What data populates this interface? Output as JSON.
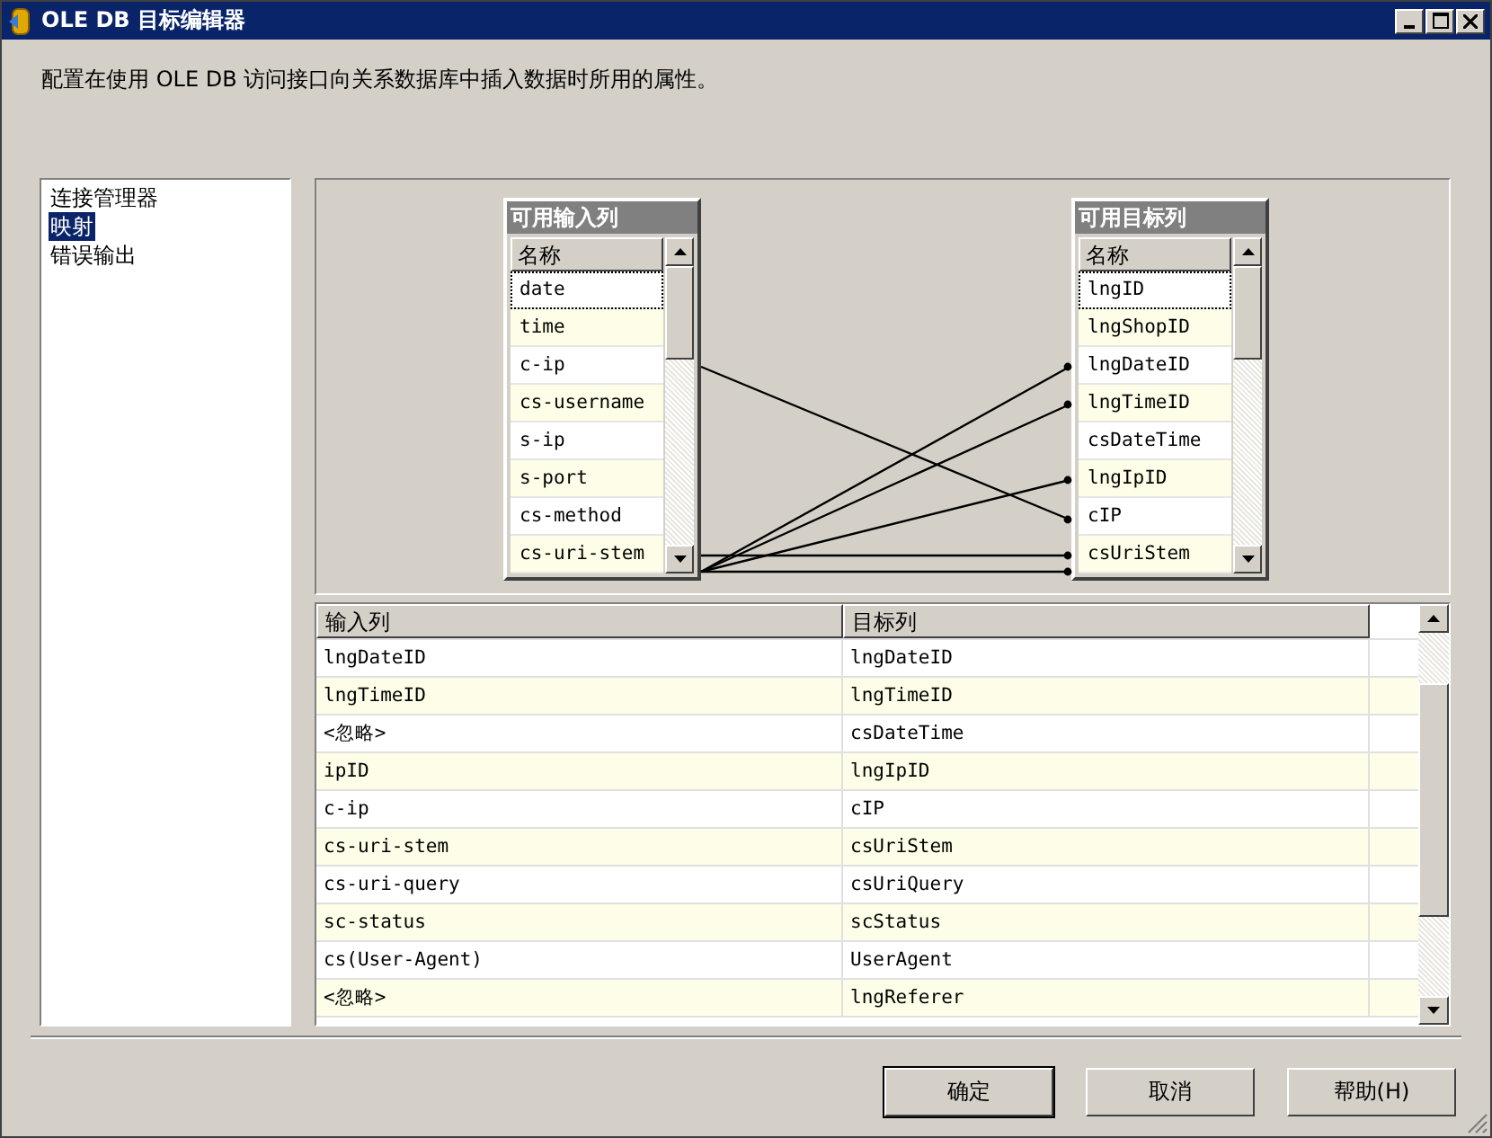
{
  "window": {
    "title": "OLE DB 目标编辑器"
  },
  "description": "配置在使用 OLE DB 访问接口向关系数据库中插入数据时所用的属性。",
  "nav": [
    {
      "label": "连接管理器",
      "selected": false
    },
    {
      "label": "映射",
      "selected": true
    },
    {
      "label": "错误输出",
      "selected": false
    }
  ],
  "input_columns": {
    "title": "可用输入列",
    "header": "名称",
    "rows": [
      {
        "name": "date",
        "focused": true
      },
      {
        "name": "time",
        "focused": false
      },
      {
        "name": "c-ip",
        "focused": false
      },
      {
        "name": "cs-username",
        "focused": false
      },
      {
        "name": "s-ip",
        "focused": false
      },
      {
        "name": "s-port",
        "focused": false
      },
      {
        "name": "cs-method",
        "focused": false
      },
      {
        "name": "cs-uri-stem",
        "focused": false
      }
    ]
  },
  "target_columns": {
    "title": "可用目标列",
    "header": "名称",
    "rows": [
      {
        "name": "lngID",
        "focused": true
      },
      {
        "name": "lngShopID",
        "focused": false
      },
      {
        "name": "lngDateID",
        "focused": false
      },
      {
        "name": "lngTimeID",
        "focused": false
      },
      {
        "name": "csDateTime",
        "focused": false
      },
      {
        "name": "lngIpID",
        "focused": false
      },
      {
        "name": "cIP",
        "focused": false
      },
      {
        "name": "csUriStem",
        "focused": false
      }
    ]
  },
  "mapping_table": {
    "columns": [
      "输入列",
      "目标列"
    ],
    "rows": [
      {
        "input": "lngDateID",
        "target": "lngDateID"
      },
      {
        "input": "lngTimeID",
        "target": "lngTimeID"
      },
      {
        "input": "<忽略>",
        "target": "csDateTime"
      },
      {
        "input": "ipID",
        "target": "lngIpID"
      },
      {
        "input": "c-ip",
        "target": "cIP"
      },
      {
        "input": "cs-uri-stem",
        "target": "csUriStem"
      },
      {
        "input": "cs-uri-query",
        "target": "csUriQuery"
      },
      {
        "input": "sc-status",
        "target": "scStatus"
      },
      {
        "input": "cs(User-Agent)",
        "target": "UserAgent"
      },
      {
        "input": "<忽略>",
        "target": "lngReferer"
      }
    ]
  },
  "buttons": [
    {
      "label": "确定",
      "default": true
    },
    {
      "label": "取消",
      "default": false
    },
    {
      "label": "帮助(H)",
      "default": false
    }
  ]
}
